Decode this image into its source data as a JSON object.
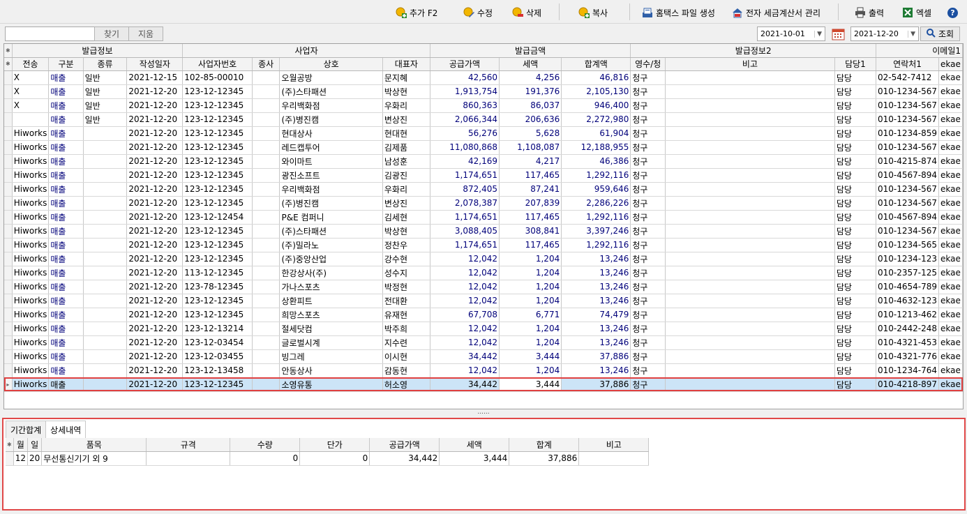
{
  "toolbar": {
    "add_label": "추가 F2",
    "edit_label": "수정",
    "delete_label": "삭제",
    "copy_label": "복사",
    "hometax_label": "홈택스 파일 생성",
    "etax_label": "전자 세금계산서 관리",
    "print_label": "출력",
    "excel_label": "엑셀",
    "help_label": "?"
  },
  "search": {
    "value": "",
    "find_label": "찾기",
    "clear_label": "지움",
    "date_from": "2021-10-01",
    "date_to": "2021-12-20",
    "query_label": "조회"
  },
  "grid": {
    "groups": [
      "발급정보",
      "사업자",
      "발급금액",
      "발급정보2",
      "이메일1"
    ],
    "columns": [
      "전송",
      "구분",
      "종류",
      "작성일자",
      "사업자번호",
      "종사",
      "상호",
      "대표자",
      "공급가액",
      "세액",
      "합계액",
      "영수/청",
      "비고",
      "담당1",
      "연락처1",
      "ekae"
    ],
    "rows": [
      [
        "X",
        "매출",
        "일반",
        "2021-12-15",
        "102-85-00010",
        "",
        "오월공방",
        "문지혜",
        "42,560",
        "4,256",
        "46,816",
        "청구",
        "",
        "담당",
        "02-542-7412",
        "ekae"
      ],
      [
        "X",
        "매출",
        "일반",
        "2021-12-20",
        "123-12-12345",
        "",
        "(주)스타패션",
        "박상현",
        "1,913,754",
        "191,376",
        "2,105,130",
        "청구",
        "",
        "담당",
        "010-1234-567",
        "ekae"
      ],
      [
        "X",
        "매출",
        "일반",
        "2021-12-20",
        "123-12-12345",
        "",
        "우리백화점",
        "우화리",
        "860,363",
        "86,037",
        "946,400",
        "청구",
        "",
        "담당",
        "010-1234-567",
        "ekae"
      ],
      [
        "",
        "매출",
        "일반",
        "2021-12-20",
        "123-12-12345",
        "",
        "(주)병진캠",
        "변상진",
        "2,066,344",
        "206,636",
        "2,272,980",
        "청구",
        "",
        "담당",
        "010-1234-567",
        "ekae"
      ],
      [
        "Hiworks",
        "매출",
        "",
        "2021-12-20",
        "123-12-12345",
        "",
        "현대상사",
        "현대현",
        "56,276",
        "5,628",
        "61,904",
        "청구",
        "",
        "담당",
        "010-1234-859",
        "ekae"
      ],
      [
        "Hiworks",
        "매출",
        "",
        "2021-12-20",
        "123-12-12345",
        "",
        "레드캡투어",
        "김제품",
        "11,080,868",
        "1,108,087",
        "12,188,955",
        "청구",
        "",
        "담당",
        "010-1234-567",
        "ekae"
      ],
      [
        "Hiworks",
        "매출",
        "",
        "2021-12-20",
        "123-12-12345",
        "",
        "와이마트",
        "남성훈",
        "42,169",
        "4,217",
        "46,386",
        "청구",
        "",
        "담당",
        "010-4215-874",
        "ekae"
      ],
      [
        "Hiworks",
        "매출",
        "",
        "2021-12-20",
        "123-12-12345",
        "",
        "광진소프트",
        "김광진",
        "1,174,651",
        "117,465",
        "1,292,116",
        "청구",
        "",
        "담당",
        "010-4567-894",
        "ekae"
      ],
      [
        "Hiworks",
        "매출",
        "",
        "2021-12-20",
        "123-12-12345",
        "",
        "우리백화점",
        "우화리",
        "872,405",
        "87,241",
        "959,646",
        "청구",
        "",
        "담당",
        "010-1234-567",
        "ekae"
      ],
      [
        "Hiworks",
        "매출",
        "",
        "2021-12-20",
        "123-12-12345",
        "",
        "(주)병진캠",
        "변상진",
        "2,078,387",
        "207,839",
        "2,286,226",
        "청구",
        "",
        "담당",
        "010-1234-567",
        "ekae"
      ],
      [
        "Hiworks",
        "매출",
        "",
        "2021-12-20",
        "123-12-12454",
        "",
        "P&E 컴퍼니",
        "김세현",
        "1,174,651",
        "117,465",
        "1,292,116",
        "청구",
        "",
        "담당",
        "010-4567-894",
        "ekae"
      ],
      [
        "Hiworks",
        "매출",
        "",
        "2021-12-20",
        "123-12-12345",
        "",
        "(주)스타패션",
        "박상현",
        "3,088,405",
        "308,841",
        "3,397,246",
        "청구",
        "",
        "담당",
        "010-1234-567",
        "ekae"
      ],
      [
        "Hiworks",
        "매출",
        "",
        "2021-12-20",
        "123-12-12345",
        "",
        "(주)밀라노",
        "정찬우",
        "1,174,651",
        "117,465",
        "1,292,116",
        "청구",
        "",
        "담당",
        "010-1234-565",
        "ekae"
      ],
      [
        "Hiworks",
        "매출",
        "",
        "2021-12-20",
        "123-12-12345",
        "",
        "(주)중앙산업",
        "강수현",
        "12,042",
        "1,204",
        "13,246",
        "청구",
        "",
        "담당",
        "010-1234-123",
        "ekae"
      ],
      [
        "Hiworks",
        "매출",
        "",
        "2021-12-20",
        "113-12-12345",
        "",
        "한강상사(주)",
        "성수지",
        "12,042",
        "1,204",
        "13,246",
        "청구",
        "",
        "담당",
        "010-2357-125",
        "ekae"
      ],
      [
        "Hiworks",
        "매출",
        "",
        "2021-12-20",
        "123-78-12345",
        "",
        "가나스포츠",
        "박정현",
        "12,042",
        "1,204",
        "13,246",
        "청구",
        "",
        "담당",
        "010-4654-789",
        "ekae"
      ],
      [
        "Hiworks",
        "매출",
        "",
        "2021-12-20",
        "123-12-12345",
        "",
        "상환피트",
        "전대환",
        "12,042",
        "1,204",
        "13,246",
        "청구",
        "",
        "담당",
        "010-4632-123",
        "ekae"
      ],
      [
        "Hiworks",
        "매출",
        "",
        "2021-12-20",
        "123-12-12345",
        "",
        "희망스포츠",
        "유재현",
        "67,708",
        "6,771",
        "74,479",
        "청구",
        "",
        "담당",
        "010-1213-462",
        "ekae"
      ],
      [
        "Hiworks",
        "매출",
        "",
        "2021-12-20",
        "123-12-13214",
        "",
        "절세닷컴",
        "박주희",
        "12,042",
        "1,204",
        "13,246",
        "청구",
        "",
        "담당",
        "010-2442-248",
        "ekae"
      ],
      [
        "Hiworks",
        "매출",
        "",
        "2021-12-20",
        "123-12-03454",
        "",
        "글로벌시계",
        "지수련",
        "12,042",
        "1,204",
        "13,246",
        "청구",
        "",
        "담당",
        "010-4321-453",
        "ekae"
      ],
      [
        "Hiworks",
        "매출",
        "",
        "2021-12-20",
        "123-12-03455",
        "",
        "빙그레",
        "이시현",
        "34,442",
        "3,444",
        "37,886",
        "청구",
        "",
        "담당",
        "010-4321-776",
        "ekae"
      ],
      [
        "Hiworks",
        "매출",
        "",
        "2021-12-20",
        "123-12-13458",
        "",
        "안동상사",
        "감동현",
        "12,042",
        "1,204",
        "13,246",
        "청구",
        "",
        "담당",
        "010-1234-764",
        "ekae"
      ],
      [
        "Hiworks",
        "매출",
        "",
        "2021-12-20",
        "123-12-12345",
        "",
        "소영유통",
        "허소영",
        "34,442",
        "3,444",
        "37,886",
        "청구",
        "",
        "담당",
        "010-4218-897",
        "ekae"
      ]
    ]
  },
  "splitter_label": "......",
  "detail": {
    "tabs": [
      "기간합계",
      "상세내역"
    ],
    "columns": [
      "월",
      "일",
      "품목",
      "규격",
      "수량",
      "단가",
      "공급가액",
      "세액",
      "합계",
      "비고"
    ],
    "rows": [
      [
        "12",
        "20",
        "무선통신기기 외 9",
        "",
        "0",
        "0",
        "34,442",
        "3,444",
        "37,886",
        ""
      ]
    ]
  }
}
